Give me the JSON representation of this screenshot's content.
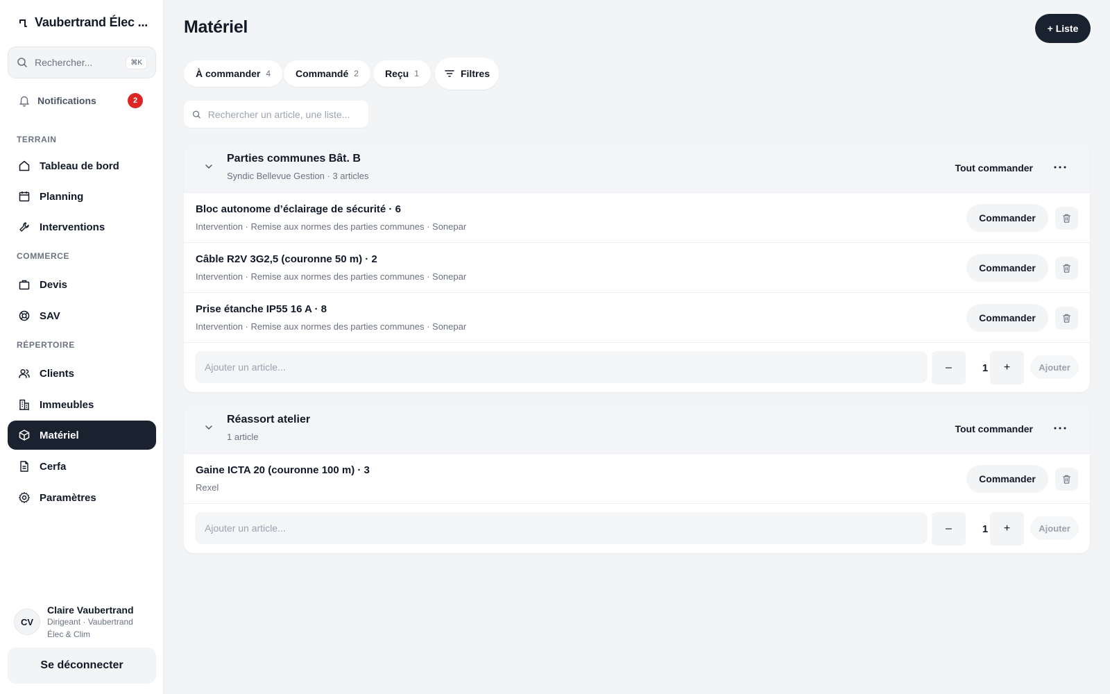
{
  "sidebar": {
    "brand": "Vaubertrand Élec ...",
    "search": {
      "placeholder": "Rechercher...",
      "shortcut": "⌘K"
    },
    "notifications": {
      "label": "Notifications",
      "count": "2"
    },
    "sections": {
      "terrain": "TERRAIN",
      "commerce": "COMMERCE",
      "repertoire": "RÉPERTOIRE"
    },
    "items": [
      {
        "label": "Tableau de bord",
        "icon": "home-icon"
      },
      {
        "label": "Planning",
        "icon": "calendar-icon"
      },
      {
        "label": "Interventions",
        "icon": "wrench-icon"
      },
      {
        "label": "Devis",
        "icon": "briefcase-icon"
      },
      {
        "label": "SAV",
        "icon": "lifebuoy-icon"
      },
      {
        "label": "Clients",
        "icon": "users-icon"
      },
      {
        "label": "Immeubles",
        "icon": "building-icon"
      },
      {
        "label": "Matériel",
        "icon": "box-icon",
        "active": true
      },
      {
        "label": "Cerfa",
        "icon": "document-icon"
      },
      {
        "label": "Paramètres",
        "icon": "gear-icon"
      }
    ],
    "user": {
      "initials": "CV",
      "name": "Claire Vaubertrand",
      "role": "Dirigeant · Vaubertrand Élec & Clim"
    },
    "logout": "Se déconnecter"
  },
  "main": {
    "title": "Matériel",
    "new_list": "+ Liste",
    "chips": [
      {
        "label": "À commander",
        "count": "4"
      },
      {
        "label": "Commandé",
        "count": "2"
      },
      {
        "label": "Reçu",
        "count": "1"
      }
    ],
    "filters": "Filtres",
    "search_placeholder": "Rechercher un article, une liste...",
    "order_all": "Tout commander",
    "order_label": "Commander",
    "add_placeholder": "Ajouter un article...",
    "minus": "–",
    "plus": "+",
    "add_label": "Ajouter",
    "groups": [
      {
        "title": "Parties communes Bât. B",
        "subtitle": "Syndic Bellevue Gestion · 3 articles",
        "items": [
          {
            "title": "Bloc autonome d’éclairage de sécurité · 6",
            "meta": "Intervention · Remise aux normes des parties communes · Sonepar"
          },
          {
            "title": "Câble R2V 3G2,5 (couronne 50 m) · 2",
            "meta": "Intervention · Remise aux normes des parties communes · Sonepar"
          },
          {
            "title": "Prise étanche IP55 16 A · 8",
            "meta": "Intervention · Remise aux normes des parties communes · Sonepar"
          }
        ],
        "qty": "1"
      },
      {
        "title": "Réassort atelier",
        "subtitle": "1 article",
        "items": [
          {
            "title": "Gaine ICTA 20 (couronne 100 m) · 3",
            "meta": "Rexel"
          }
        ],
        "qty": "1"
      }
    ]
  },
  "colors": {
    "accent": "#1a2230",
    "badge": "#dc2626",
    "background": "#f3f4f6"
  }
}
